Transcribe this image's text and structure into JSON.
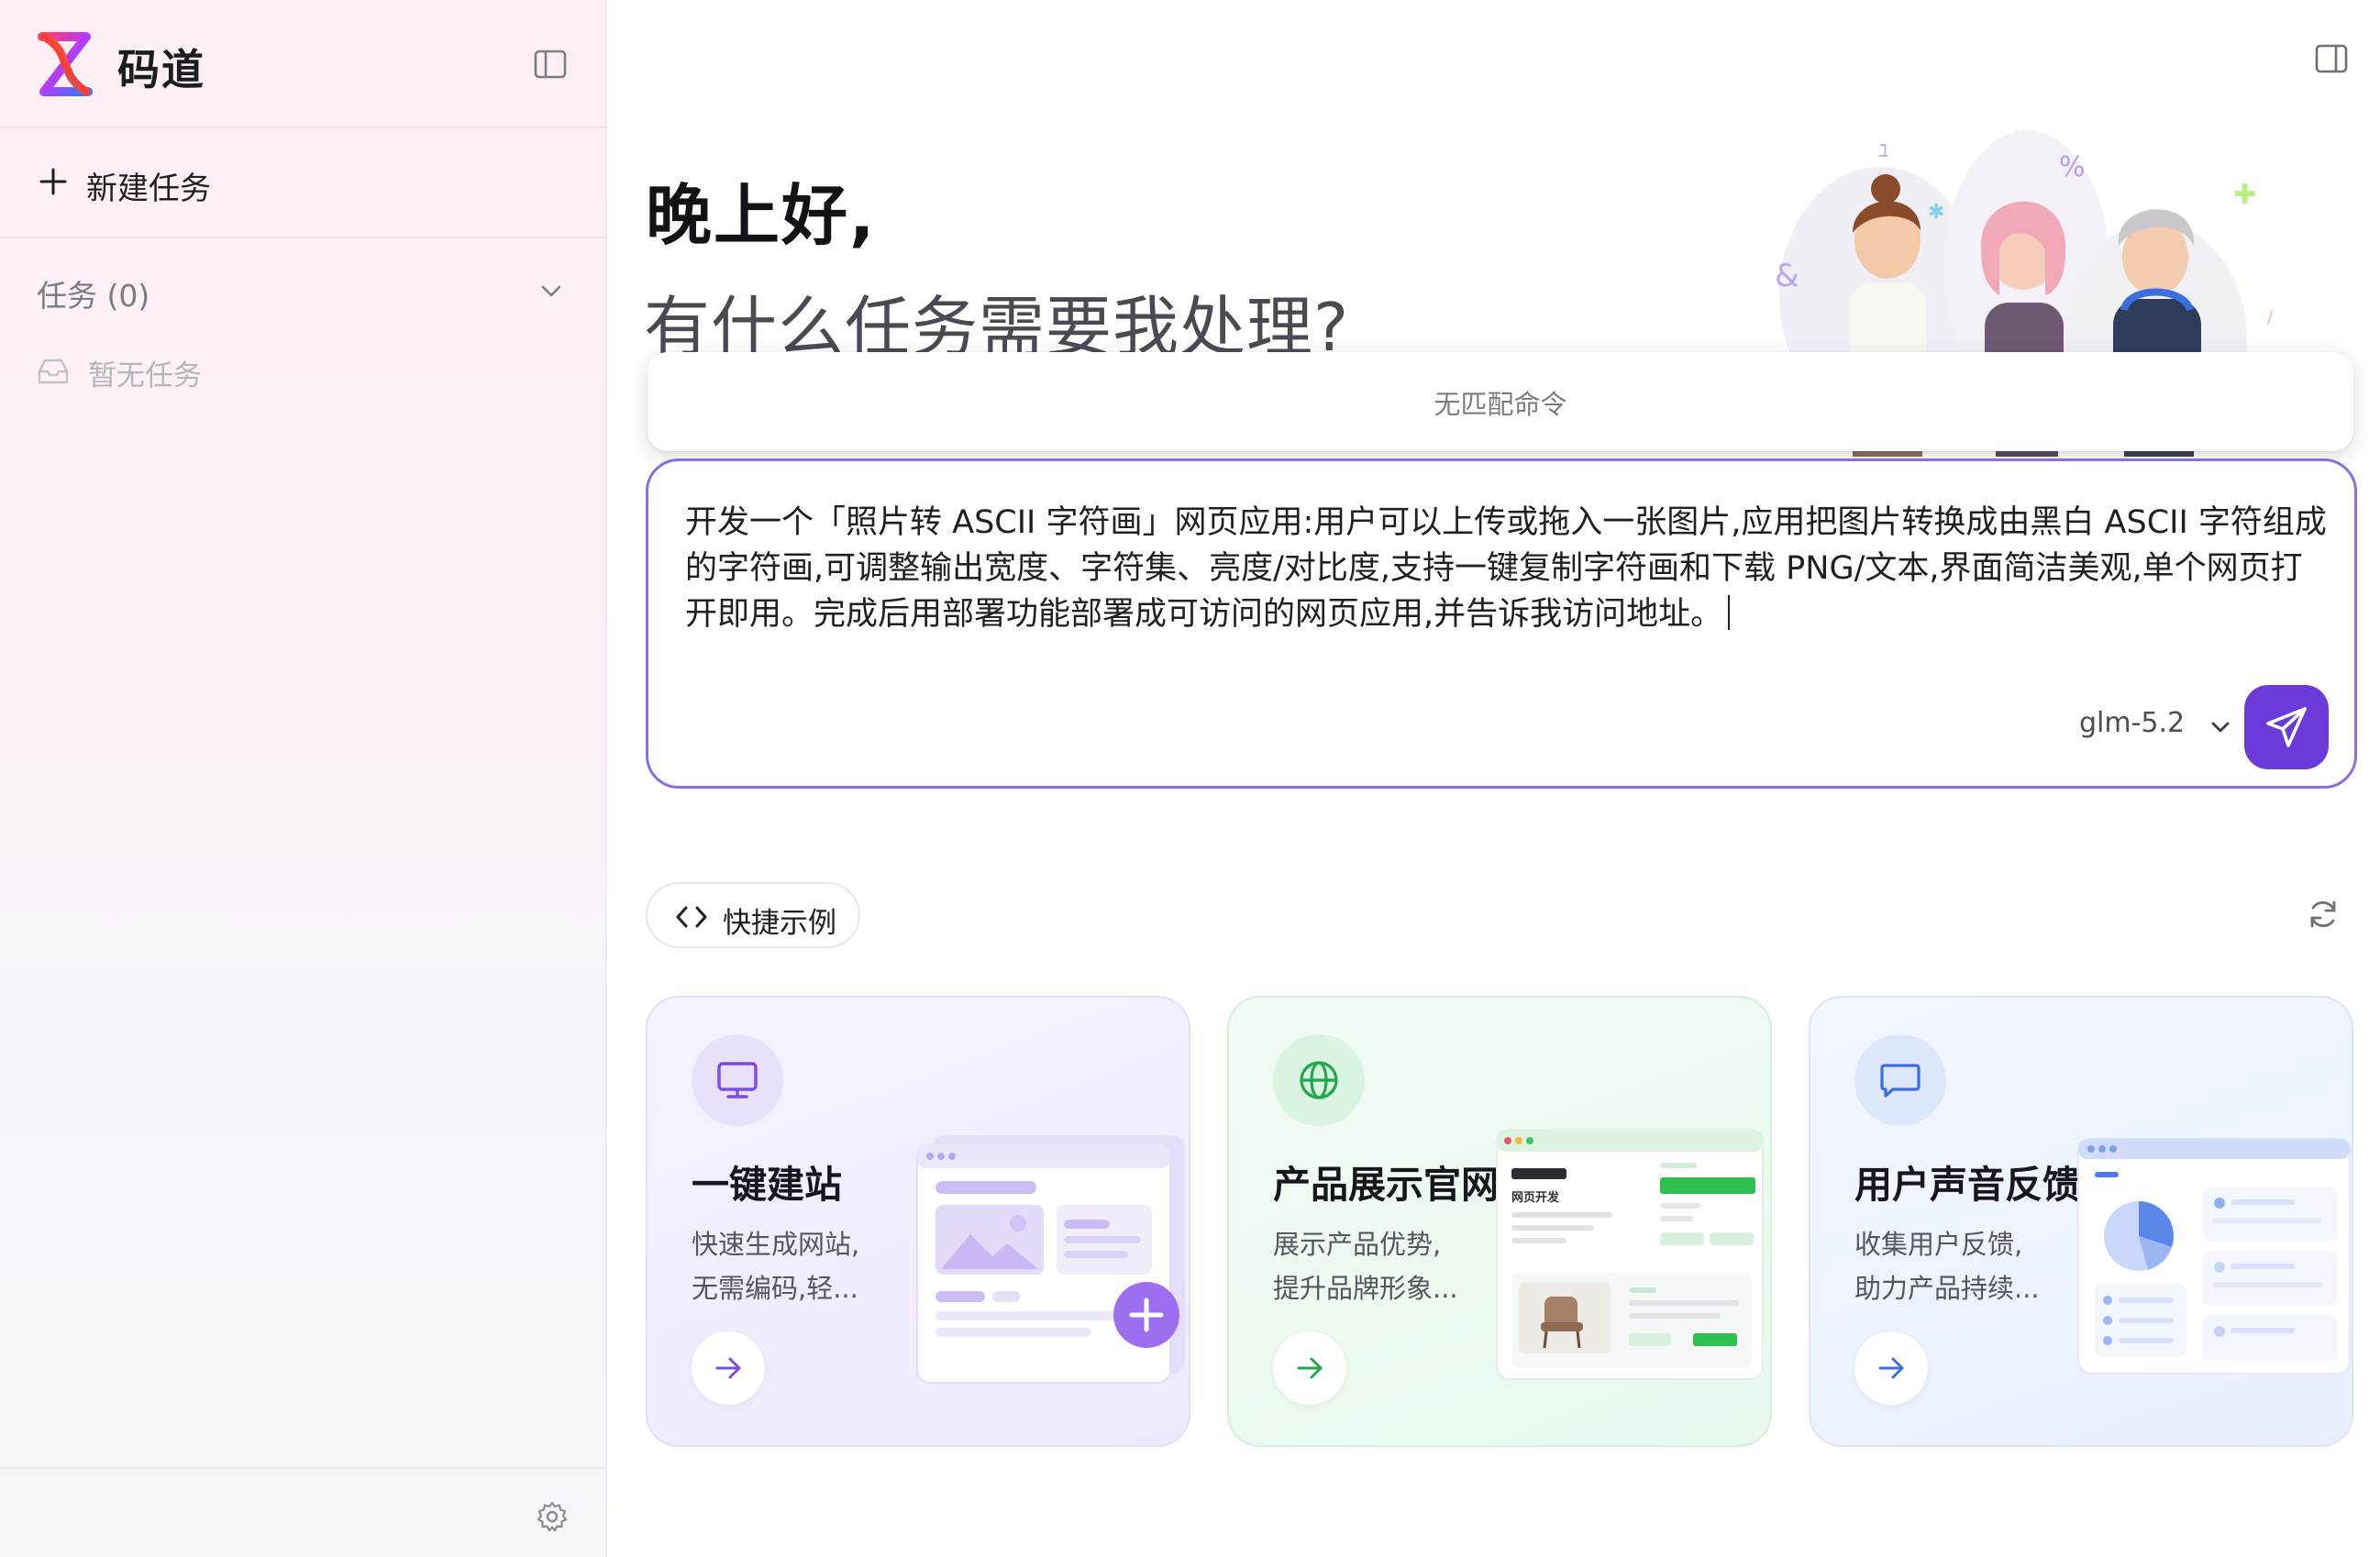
{
  "app": {
    "title": "码道"
  },
  "sidebar": {
    "new_task_label": "新建任务",
    "tasks_header": "任务 (0)",
    "empty_label": "暂无任务"
  },
  "main": {
    "greeting": "晚上好,",
    "subtitle": "有什么任务需要我处理?",
    "command_popup": "无匹配命令",
    "prompt_text": "开发一个「照片转 ASCII 字符画」网页应用:用户可以上传或拖入一张图片,应用把图片转换成由黑白 ASCII 字符组成的字符画,可调整输出宽度、字符集、亮度/对比度,支持一键复制字符画和下载 PNG/文本,界面简洁美观,单个网页打开即用。完成后用部署功能部署成可访问的网页应用,并告诉我访问地址。",
    "model": "glm-5.2",
    "quick_examples_label": "快捷示例"
  },
  "cards": [
    {
      "title": "一键建站",
      "desc_line1": "快速生成网站,",
      "desc_line2": "无需编码,轻...",
      "icon": "monitor-icon",
      "accent": "#7c4dde"
    },
    {
      "title": "产品展示官网",
      "desc_line1": "展示产品优势,",
      "desc_line2": "提升品牌形象...",
      "icon": "globe-icon",
      "accent": "#22a84a",
      "mock_text": "网页开发"
    },
    {
      "title": "用户声音反馈",
      "desc_line1": "收集用户反馈,",
      "desc_line2": "助力产品持续...",
      "icon": "message-icon",
      "accent": "#3b6fe0"
    }
  ],
  "colors": {
    "brand_purple": "#6b3ad9",
    "composer_border": "#8b6fe0",
    "sidebar_bg": "#fcf0f5"
  }
}
